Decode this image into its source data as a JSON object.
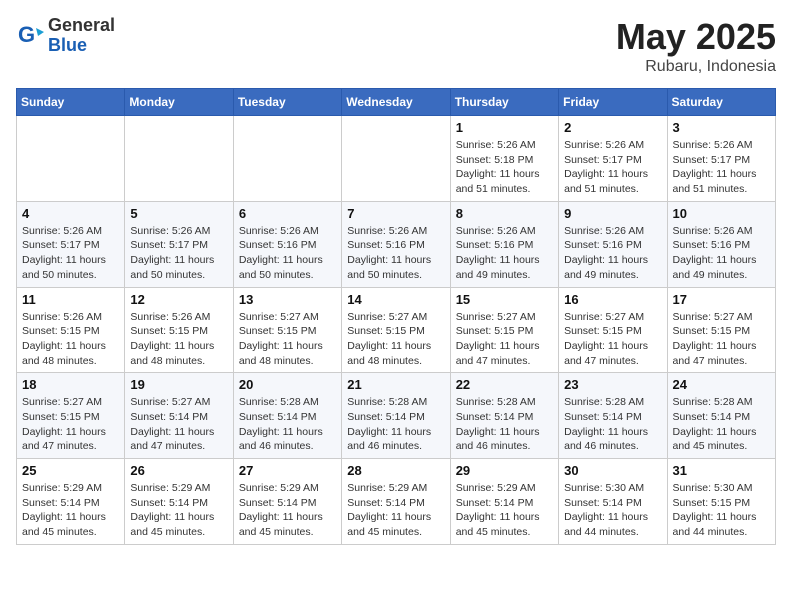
{
  "header": {
    "logo_general": "General",
    "logo_blue": "Blue",
    "month": "May 2025",
    "location": "Rubaru, Indonesia"
  },
  "weekdays": [
    "Sunday",
    "Monday",
    "Tuesday",
    "Wednesday",
    "Thursday",
    "Friday",
    "Saturday"
  ],
  "weeks": [
    [
      {
        "day": "",
        "detail": ""
      },
      {
        "day": "",
        "detail": ""
      },
      {
        "day": "",
        "detail": ""
      },
      {
        "day": "",
        "detail": ""
      },
      {
        "day": "1",
        "detail": "Sunrise: 5:26 AM\nSunset: 5:18 PM\nDaylight: 11 hours\nand 51 minutes."
      },
      {
        "day": "2",
        "detail": "Sunrise: 5:26 AM\nSunset: 5:17 PM\nDaylight: 11 hours\nand 51 minutes."
      },
      {
        "day": "3",
        "detail": "Sunrise: 5:26 AM\nSunset: 5:17 PM\nDaylight: 11 hours\nand 51 minutes."
      }
    ],
    [
      {
        "day": "4",
        "detail": "Sunrise: 5:26 AM\nSunset: 5:17 PM\nDaylight: 11 hours\nand 50 minutes."
      },
      {
        "day": "5",
        "detail": "Sunrise: 5:26 AM\nSunset: 5:17 PM\nDaylight: 11 hours\nand 50 minutes."
      },
      {
        "day": "6",
        "detail": "Sunrise: 5:26 AM\nSunset: 5:16 PM\nDaylight: 11 hours\nand 50 minutes."
      },
      {
        "day": "7",
        "detail": "Sunrise: 5:26 AM\nSunset: 5:16 PM\nDaylight: 11 hours\nand 50 minutes."
      },
      {
        "day": "8",
        "detail": "Sunrise: 5:26 AM\nSunset: 5:16 PM\nDaylight: 11 hours\nand 49 minutes."
      },
      {
        "day": "9",
        "detail": "Sunrise: 5:26 AM\nSunset: 5:16 PM\nDaylight: 11 hours\nand 49 minutes."
      },
      {
        "day": "10",
        "detail": "Sunrise: 5:26 AM\nSunset: 5:16 PM\nDaylight: 11 hours\nand 49 minutes."
      }
    ],
    [
      {
        "day": "11",
        "detail": "Sunrise: 5:26 AM\nSunset: 5:15 PM\nDaylight: 11 hours\nand 48 minutes."
      },
      {
        "day": "12",
        "detail": "Sunrise: 5:26 AM\nSunset: 5:15 PM\nDaylight: 11 hours\nand 48 minutes."
      },
      {
        "day": "13",
        "detail": "Sunrise: 5:27 AM\nSunset: 5:15 PM\nDaylight: 11 hours\nand 48 minutes."
      },
      {
        "day": "14",
        "detail": "Sunrise: 5:27 AM\nSunset: 5:15 PM\nDaylight: 11 hours\nand 48 minutes."
      },
      {
        "day": "15",
        "detail": "Sunrise: 5:27 AM\nSunset: 5:15 PM\nDaylight: 11 hours\nand 47 minutes."
      },
      {
        "day": "16",
        "detail": "Sunrise: 5:27 AM\nSunset: 5:15 PM\nDaylight: 11 hours\nand 47 minutes."
      },
      {
        "day": "17",
        "detail": "Sunrise: 5:27 AM\nSunset: 5:15 PM\nDaylight: 11 hours\nand 47 minutes."
      }
    ],
    [
      {
        "day": "18",
        "detail": "Sunrise: 5:27 AM\nSunset: 5:15 PM\nDaylight: 11 hours\nand 47 minutes."
      },
      {
        "day": "19",
        "detail": "Sunrise: 5:27 AM\nSunset: 5:14 PM\nDaylight: 11 hours\nand 47 minutes."
      },
      {
        "day": "20",
        "detail": "Sunrise: 5:28 AM\nSunset: 5:14 PM\nDaylight: 11 hours\nand 46 minutes."
      },
      {
        "day": "21",
        "detail": "Sunrise: 5:28 AM\nSunset: 5:14 PM\nDaylight: 11 hours\nand 46 minutes."
      },
      {
        "day": "22",
        "detail": "Sunrise: 5:28 AM\nSunset: 5:14 PM\nDaylight: 11 hours\nand 46 minutes."
      },
      {
        "day": "23",
        "detail": "Sunrise: 5:28 AM\nSunset: 5:14 PM\nDaylight: 11 hours\nand 46 minutes."
      },
      {
        "day": "24",
        "detail": "Sunrise: 5:28 AM\nSunset: 5:14 PM\nDaylight: 11 hours\nand 45 minutes."
      }
    ],
    [
      {
        "day": "25",
        "detail": "Sunrise: 5:29 AM\nSunset: 5:14 PM\nDaylight: 11 hours\nand 45 minutes."
      },
      {
        "day": "26",
        "detail": "Sunrise: 5:29 AM\nSunset: 5:14 PM\nDaylight: 11 hours\nand 45 minutes."
      },
      {
        "day": "27",
        "detail": "Sunrise: 5:29 AM\nSunset: 5:14 PM\nDaylight: 11 hours\nand 45 minutes."
      },
      {
        "day": "28",
        "detail": "Sunrise: 5:29 AM\nSunset: 5:14 PM\nDaylight: 11 hours\nand 45 minutes."
      },
      {
        "day": "29",
        "detail": "Sunrise: 5:29 AM\nSunset: 5:14 PM\nDaylight: 11 hours\nand 45 minutes."
      },
      {
        "day": "30",
        "detail": "Sunrise: 5:30 AM\nSunset: 5:14 PM\nDaylight: 11 hours\nand 44 minutes."
      },
      {
        "day": "31",
        "detail": "Sunrise: 5:30 AM\nSunset: 5:15 PM\nDaylight: 11 hours\nand 44 minutes."
      }
    ]
  ]
}
